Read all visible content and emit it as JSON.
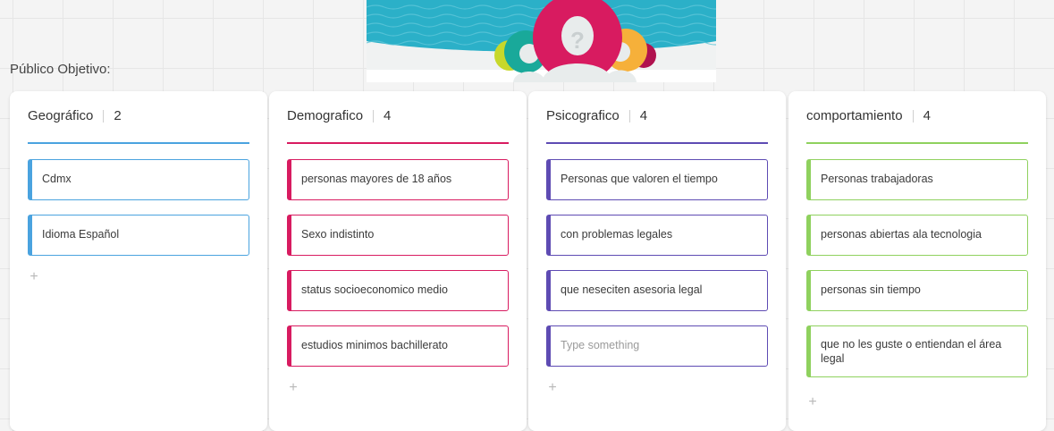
{
  "board": {
    "title": "Público Objetivo:"
  },
  "banner": {
    "placeholder_glyph": "?"
  },
  "add_glyph": "+",
  "columns": [
    {
      "title": "Geográfico",
      "count": "2",
      "accent": "#4aa3df",
      "cards": [
        {
          "text": "Cdmx"
        },
        {
          "text": "Idioma Español"
        }
      ]
    },
    {
      "title": "Demografico",
      "count": "4",
      "accent": "#d81b60",
      "cards": [
        {
          "text": "personas mayores de 18 años"
        },
        {
          "text": "Sexo indistinto"
        },
        {
          "text": "status socioeconomico medio"
        },
        {
          "text": "estudios minimos bachillerato"
        }
      ]
    },
    {
      "title": "Psicografico",
      "count": "4",
      "accent": "#5e4bb3",
      "cards": [
        {
          "text": "Personas que valoren el tiempo"
        },
        {
          "text": "con problemas legales"
        },
        {
          "text": "que neseciten asesoria legal"
        },
        {
          "text": "Type something",
          "placeholder": true
        }
      ]
    },
    {
      "title": "comportamiento",
      "count": "4",
      "accent": "#8fd15e",
      "cards": [
        {
          "text": "Personas trabajadoras"
        },
        {
          "text": "personas abiertas ala tecnologia"
        },
        {
          "text": "personas sin tiempo"
        },
        {
          "text": "que no les guste o entiendan el área legal"
        }
      ]
    }
  ]
}
